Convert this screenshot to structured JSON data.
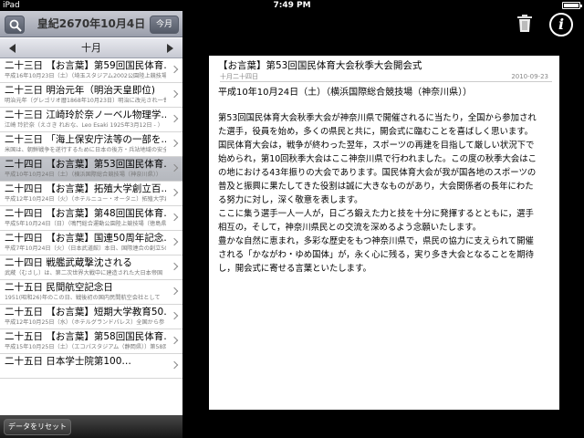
{
  "status_bar": {
    "carrier": "iPad",
    "time": "7:49 PM"
  },
  "sidebar": {
    "current_date": "皇紀2670年10月4日",
    "today_label": "今月",
    "month_label": "十月",
    "entries": [
      {
        "title": "二十三日 【お言葉】第59回国民体育…",
        "subtitle": "平成16年10月23日（土）（埼玉スタジアム2002公園陸上競技場）"
      },
      {
        "title": "二十三日 明治元年（明治天皇即位)",
        "subtitle": "明治元年（グレゴリオ暦1868年10月23日）明治に改元され一世一元の制"
      },
      {
        "title": "二十三日 江崎玲於奈ノーベル物理学…",
        "subtitle": "江崎 玲於奈（えさき れおな、Leo Esaki 1925年3月12日 - ）"
      },
      {
        "title": "二十三日 「海上保安庁法等の一部を…",
        "subtitle": "米国は、朝鮮戦争を遂行するために日本の後方・兵站地域の安全"
      },
      {
        "title": "二十四日 【お言葉】第53回国民体育…",
        "subtitle": "平成10年10月24日（土）（横浜国際総合競技場（神奈川県））"
      },
      {
        "title": "二十四日 【お言葉】拓殖大学創立百…",
        "subtitle": "平成12年10月24日（火）（ホテルニュー・オータニ）拓殖大学創立"
      },
      {
        "title": "二十四日 【お言葉】第48回国民体育…",
        "subtitle": "平成5年10月24日（日）（鳴門総合運動公園陸上競技場（徳島県"
      },
      {
        "title": "二十四日 【お言葉】国連50周年記念…",
        "subtitle": "平成7年10月24日（火）（日本武道館）本日、国際連合の創立50"
      },
      {
        "title": "二十四日 戦艦武蔵撃沈される",
        "subtitle": "武蔵（むさし）は、第二次世界大戦中に建造された大日本帝国"
      },
      {
        "title": "二十五日 民間航空記念日",
        "subtitle": "1951(昭和26)年のこの日、戦後初の国内民間航空会社として"
      },
      {
        "title": "二十五日 【お言葉】短期大学教育50…",
        "subtitle": "平成12年10月25日（水）（ホテルグランドパレス）全国から参"
      },
      {
        "title": "二十五日 【お言葉】第58回国民体育…",
        "subtitle": "平成15年10月25日（土）（エコパスタジアム（静岡県））第58回"
      },
      {
        "title": "二十五日 日本学士院第100…",
        "subtitle": ""
      }
    ],
    "reset_label": "データをリセット"
  },
  "article": {
    "title": "【お言葉】第53回国民体育大会秋季大会開会式",
    "date_jp": "十月二十四日",
    "date_iso": "2010-09-23",
    "subtitle": "平成10年10月24日（土）（横浜国際総合競技場（神奈川県））",
    "lines": [
      "第53回国民体育大会秋季大会が神奈川県で開催されるに当たり，全国から参加され",
      "た選手，役員を始め，多くの県民と共に，開会式に臨むことを喜ばしく思います。",
      "国民体育大会は，戦争が終わった翌年，スポーツの再建を目指して厳しい状況下で",
      "始められ，第10回秋季大会はここ神奈川県で行われました。この度の秋季大会はこ",
      "の地における43年振りの大会であります。国民体育大会が我が国各地のスポーツの",
      "普及と振興に果たしてきた役割は誠に大きなものがあり，大会関係者の長年にわた",
      "る努力に対し，深く敬意を表します。",
      "ここに集う選手一人一人が，日ごろ鍛えた力と技を十分に発揮するとともに，選手",
      "相互の，そして，神奈川県民との交流を深めるよう念願いたします。",
      "豊かな自然に恵まれ，多彩な歴史をもつ神奈川県で，県民の協力に支えられて開催",
      "される「かながわ・ゆめ国体」が，永く心に残る，実り多き大会となることを期待",
      "し，開会式に寄せる言葉といたします。"
    ]
  },
  "colors": {
    "selected_row": "#bdbfc5",
    "toolbar": "#9a9eab",
    "background": "#000000"
  }
}
